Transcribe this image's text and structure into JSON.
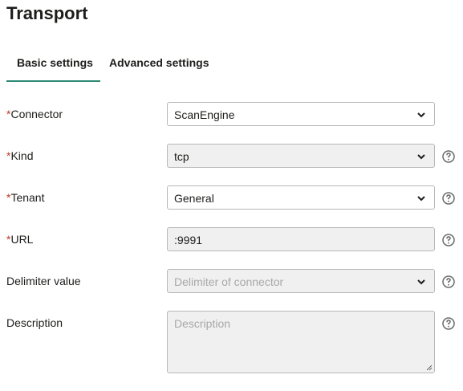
{
  "page": {
    "title": "Transport"
  },
  "tabs": [
    {
      "label": "Basic settings",
      "active": true
    },
    {
      "label": "Advanced settings",
      "active": false
    }
  ],
  "form": {
    "required_marker": "*",
    "connector": {
      "label": "Connector",
      "value": "ScanEngine"
    },
    "kind": {
      "label": "Kind",
      "value": "tcp"
    },
    "tenant": {
      "label": "Tenant",
      "value": "General"
    },
    "url": {
      "label": "URL",
      "value": ":9991"
    },
    "delimiter": {
      "label": "Delimiter value",
      "placeholder": "Delimiter of connector"
    },
    "description": {
      "label": "Description",
      "placeholder": "Description"
    }
  },
  "colors": {
    "accent": "#2e8a75",
    "required": "#c0392b",
    "disabled_bg": "#f0f0f0"
  },
  "icons": {
    "help": "question-circle-icon",
    "dropdown": "chevron-down-icon"
  }
}
